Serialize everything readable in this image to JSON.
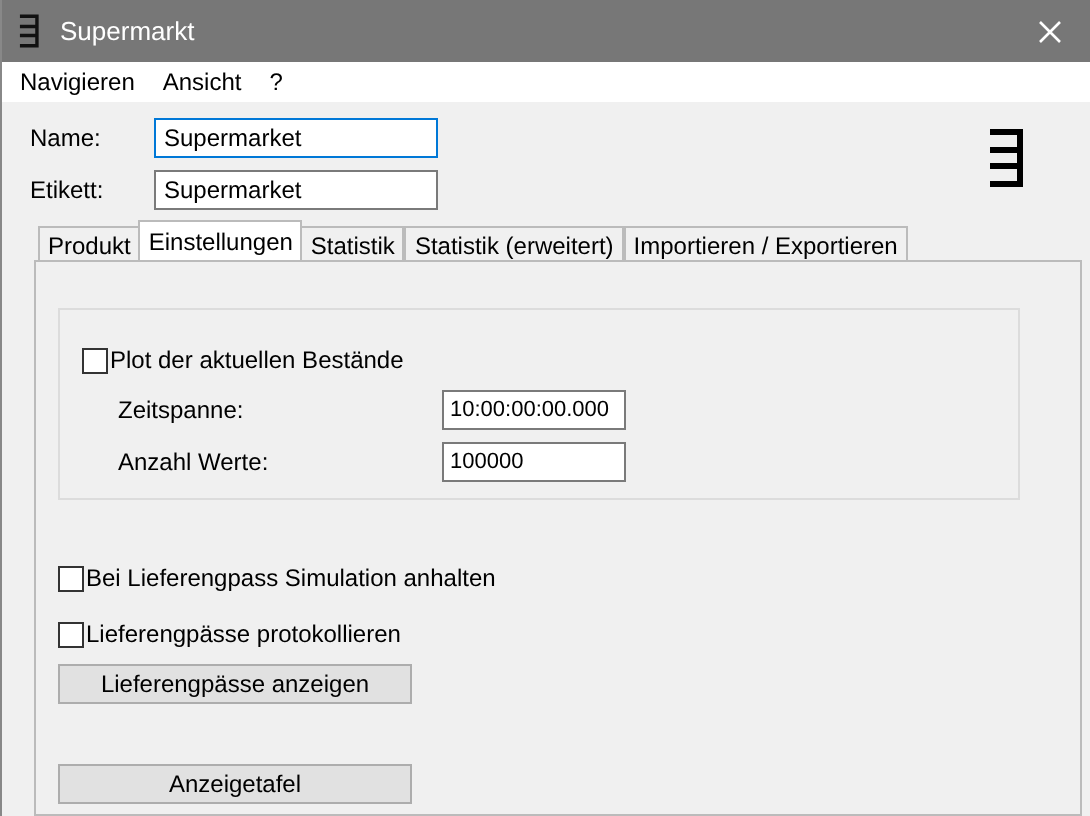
{
  "window": {
    "title": "Supermarkt"
  },
  "menu": [
    "Navigieren",
    "Ansicht",
    "?"
  ],
  "fields": [
    {
      "label": "Name:",
      "value": "Supermarket",
      "focused": true
    },
    {
      "label": "Etikett:",
      "value": "Supermarket",
      "focused": false
    }
  ],
  "tabs": [
    {
      "label": "Produkt",
      "selected": false
    },
    {
      "label": "Einstellungen",
      "selected": true
    },
    {
      "label": "Statistik",
      "selected": false
    },
    {
      "label": "Statistik (erweitert)",
      "selected": false
    },
    {
      "label": "Importieren / Exportieren",
      "selected": false
    }
  ],
  "plot_group": {
    "checkbox": {
      "label": "Plot der aktuellen Bestände",
      "checked": false
    },
    "fields": [
      {
        "label": "Zeitspanne:",
        "value": "10:00:00:00.000"
      },
      {
        "label": "Anzahl Werte:",
        "value": "100000"
      }
    ]
  },
  "checkboxes": [
    {
      "label": "Bei Lieferengpass Simulation anhalten",
      "checked": false
    },
    {
      "label": "Lieferengpässe protokollieren",
      "checked": false
    }
  ],
  "buttons": [
    "Lieferengpässe anzeigen",
    "Anzeigetafel"
  ]
}
